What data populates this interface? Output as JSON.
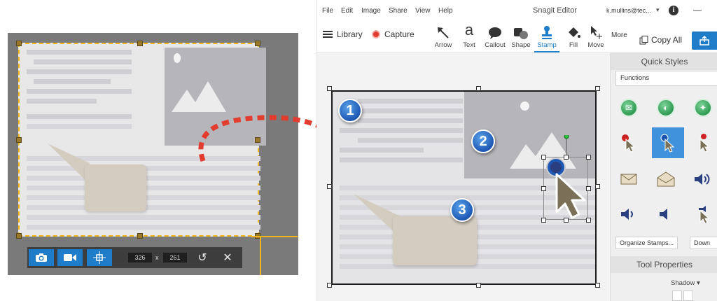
{
  "capture_panel": {
    "width_value": "326",
    "times": "x",
    "height_value": "261",
    "icons": {
      "image": "camera-icon",
      "video": "video-camera-icon",
      "move": "move-crosshair-icon",
      "reset": "rotate-icon",
      "close": "close-icon"
    }
  },
  "editor": {
    "menu": [
      "File",
      "Edit",
      "Image",
      "Share",
      "View",
      "Help"
    ],
    "title": "Snagit Editor",
    "user": "k.mullins@tec...",
    "toolbar": {
      "library": "Library",
      "capture": "Capture",
      "tools": [
        "Arrow",
        "Text",
        "Callout",
        "Shape",
        "Stamp",
        "Fill",
        "Move"
      ],
      "active_tool": "Stamp",
      "more": "More",
      "copy_all": "Copy All"
    },
    "steps": [
      "1",
      "2",
      "3"
    ],
    "side_panel": {
      "quick_styles_title": "Quick Styles",
      "category": "Functions",
      "organize_button": "Organize Stamps...",
      "download_button": "Down",
      "tool_properties_title": "Tool Properties",
      "shadow_label": "Shadow"
    }
  },
  "colors": {
    "accent": "#1e7cc8",
    "selection_dashed": "#f2b61a",
    "arrow_red": "#e23c2f",
    "step_badge": "#1d57b4"
  }
}
